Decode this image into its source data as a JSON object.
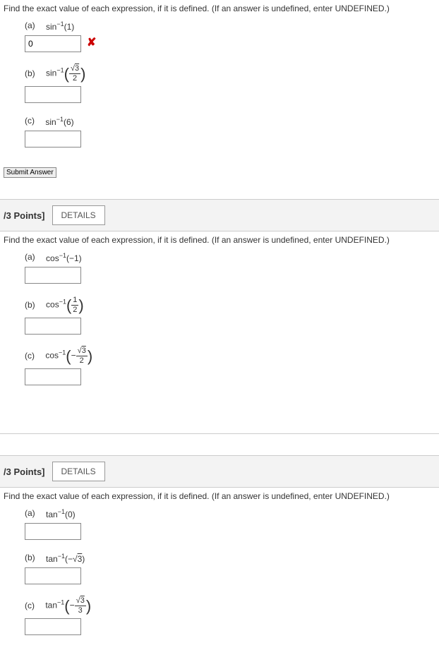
{
  "q1": {
    "instruction": "Find the exact value of each expression, if it is defined. (If an answer is undefined, enter UNDEFINED.)",
    "a": {
      "label": "(a)",
      "expr_pre": "sin",
      "sup": "−1",
      "arg": "(1)",
      "value": "0",
      "wrong": "✘"
    },
    "b": {
      "label": "(b)",
      "expr_pre": "sin",
      "sup": "−1",
      "frac_num": "√3",
      "frac_num_plain": "3",
      "frac_den": "2"
    },
    "c": {
      "label": "(c)",
      "expr_pre": "sin",
      "sup": "−1",
      "arg": "(6)"
    },
    "submit": "Submit Answer"
  },
  "q2": {
    "points": "/3 Points]",
    "details": "DETAILS",
    "instruction": "Find the exact value of each expression, if it is defined. (If an answer is undefined, enter UNDEFINED.)",
    "a": {
      "label": "(a)",
      "expr_pre": "cos",
      "sup": "−1",
      "arg": "(−1)"
    },
    "b": {
      "label": "(b)",
      "expr_pre": "cos",
      "sup": "−1",
      "frac_num": "1",
      "frac_den": "2"
    },
    "c": {
      "label": "(c)",
      "expr_pre": "cos",
      "sup": "−1",
      "neg": "−",
      "frac_num_plain": "3",
      "frac_den": "2"
    }
  },
  "q3": {
    "points": "/3 Points]",
    "details": "DETAILS",
    "instruction": "Find the exact value of each expression, if it is defined. (If an answer is undefined, enter UNDEFINED.)",
    "a": {
      "label": "(a)",
      "expr_pre": "tan",
      "sup": "−1",
      "arg": "(0)"
    },
    "b": {
      "label": "(b)",
      "expr_pre": "tan",
      "sup": "−1",
      "arg_pre": "(−",
      "arg_sqrt": "3",
      "arg_post": ")"
    },
    "c": {
      "label": "(c)",
      "expr_pre": "tan",
      "sup": "−1",
      "neg": "−",
      "frac_num_plain": "3",
      "frac_den": "3"
    }
  }
}
